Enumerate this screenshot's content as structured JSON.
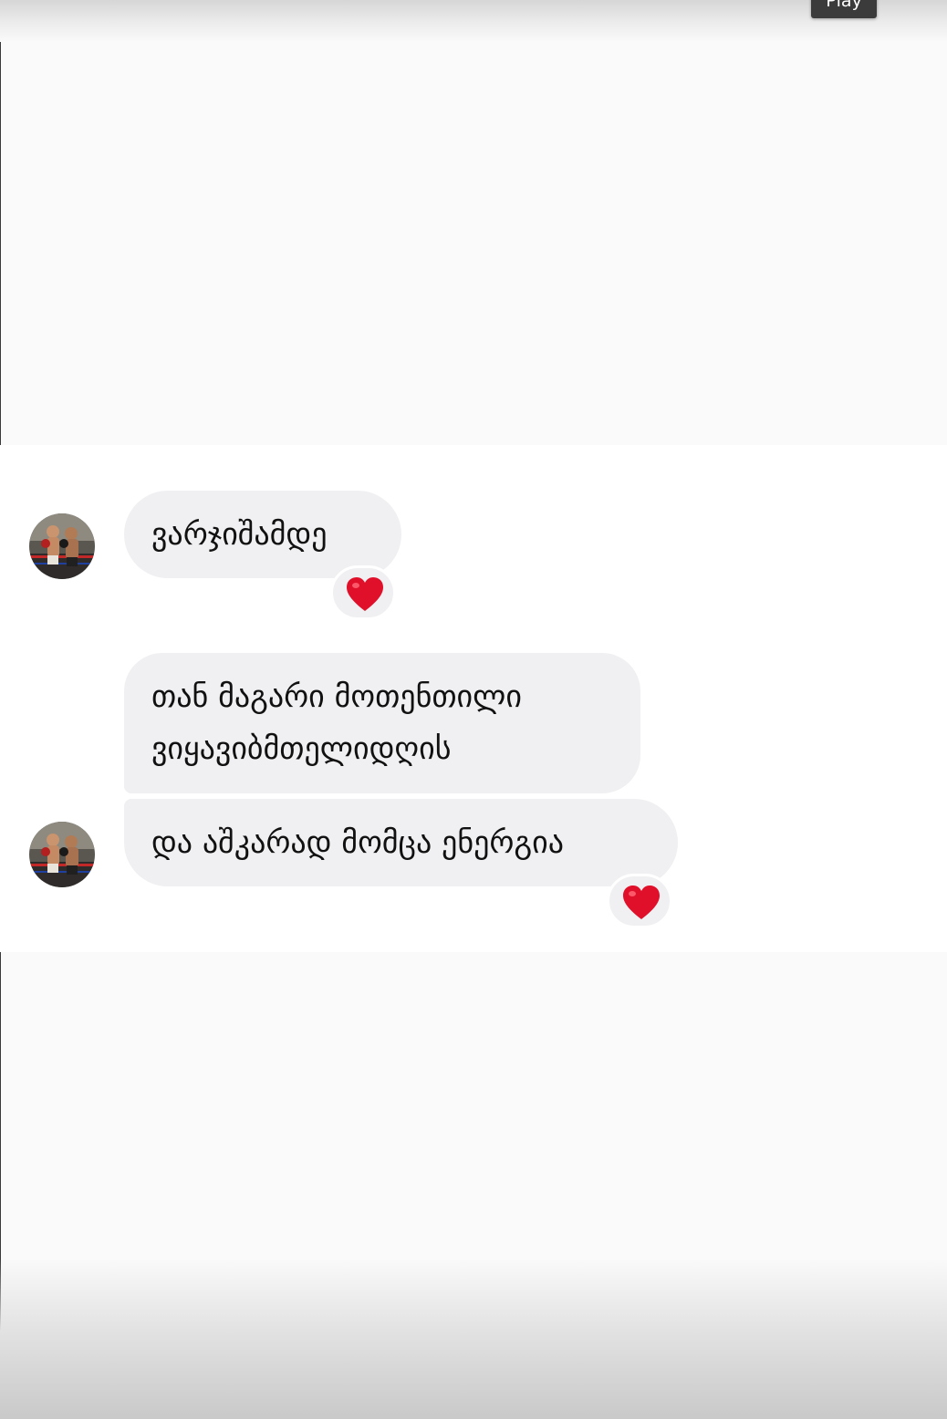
{
  "tooltip": {
    "label": "Play"
  },
  "conversation": {
    "messages": [
      {
        "text": "ვარჯიშამდე",
        "reaction": "heart-emoji"
      },
      {
        "lines": [
          "თან მაგარი მოთენთილი",
          "ვიყავიბმთელიდღის"
        ]
      },
      {
        "text": "და აშკარად მომცა ენერგია",
        "reaction": "heart-emoji"
      }
    ],
    "avatar": "boxing-avatar-photo",
    "colors": {
      "bubble": "#f0f0f2",
      "heart": "#e0102a",
      "background": "#ffffff"
    }
  }
}
